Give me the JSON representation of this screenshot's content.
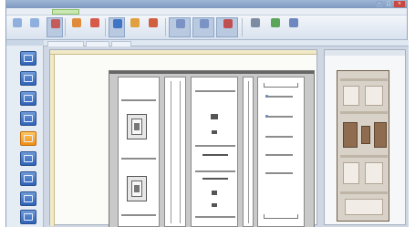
{
  "window": {
    "title": ""
  },
  "menubar": {
    "tabs": []
  },
  "ribbon": {
    "buttons": [
      {
        "icon": "arrow-left-icon",
        "color": "#8fb0dd"
      },
      {
        "icon": "arrow-right-icon",
        "color": "#8fb0dd"
      },
      {
        "icon": "select-icon",
        "color": "#c45c5c"
      },
      {
        "icon": "cabinet-icon",
        "color": "#e08b3a"
      },
      {
        "icon": "insert-icon",
        "color": "#d55a4a"
      },
      {
        "icon": "module-icon",
        "color": "#3f74c7"
      },
      {
        "icon": "rail-icon",
        "color": "#e0a040"
      },
      {
        "icon": "device-icon",
        "color": "#d06040"
      },
      {
        "icon": "layout-icon",
        "color": "#7b93c4"
      },
      {
        "icon": "grid-icon",
        "color": "#7b93c4"
      },
      {
        "icon": "panel-icon",
        "color": "#c05050"
      },
      {
        "icon": "table-icon",
        "color": "#7d8ca3"
      },
      {
        "icon": "check-icon",
        "color": "#5aa55a"
      },
      {
        "icon": "help-icon",
        "color": "#6d88c0"
      }
    ]
  },
  "left_panel": {
    "header": "",
    "buttons": [
      {
        "icon": "cabinet-view-icon",
        "color": "blue"
      },
      {
        "icon": "front-view-icon",
        "color": "blue"
      },
      {
        "icon": "side-view-icon",
        "color": "blue"
      },
      {
        "icon": "search-icon",
        "color": "blue"
      },
      {
        "icon": "module-icon",
        "color": "orange"
      },
      {
        "icon": "list-icon",
        "color": "blue"
      },
      {
        "icon": "panel-icon",
        "color": "blue"
      },
      {
        "icon": "panel-icon",
        "color": "blue"
      },
      {
        "icon": "panel-icon",
        "color": "blue"
      }
    ]
  },
  "document_tabs": [],
  "preview": {
    "title": ""
  },
  "colors": {
    "title_bar": "#7d98bf",
    "accent_blue": "#2f62b8",
    "accent_orange": "#ef8d16",
    "canvas": "#fbfbf7",
    "ruler": "#f1e9c8"
  }
}
